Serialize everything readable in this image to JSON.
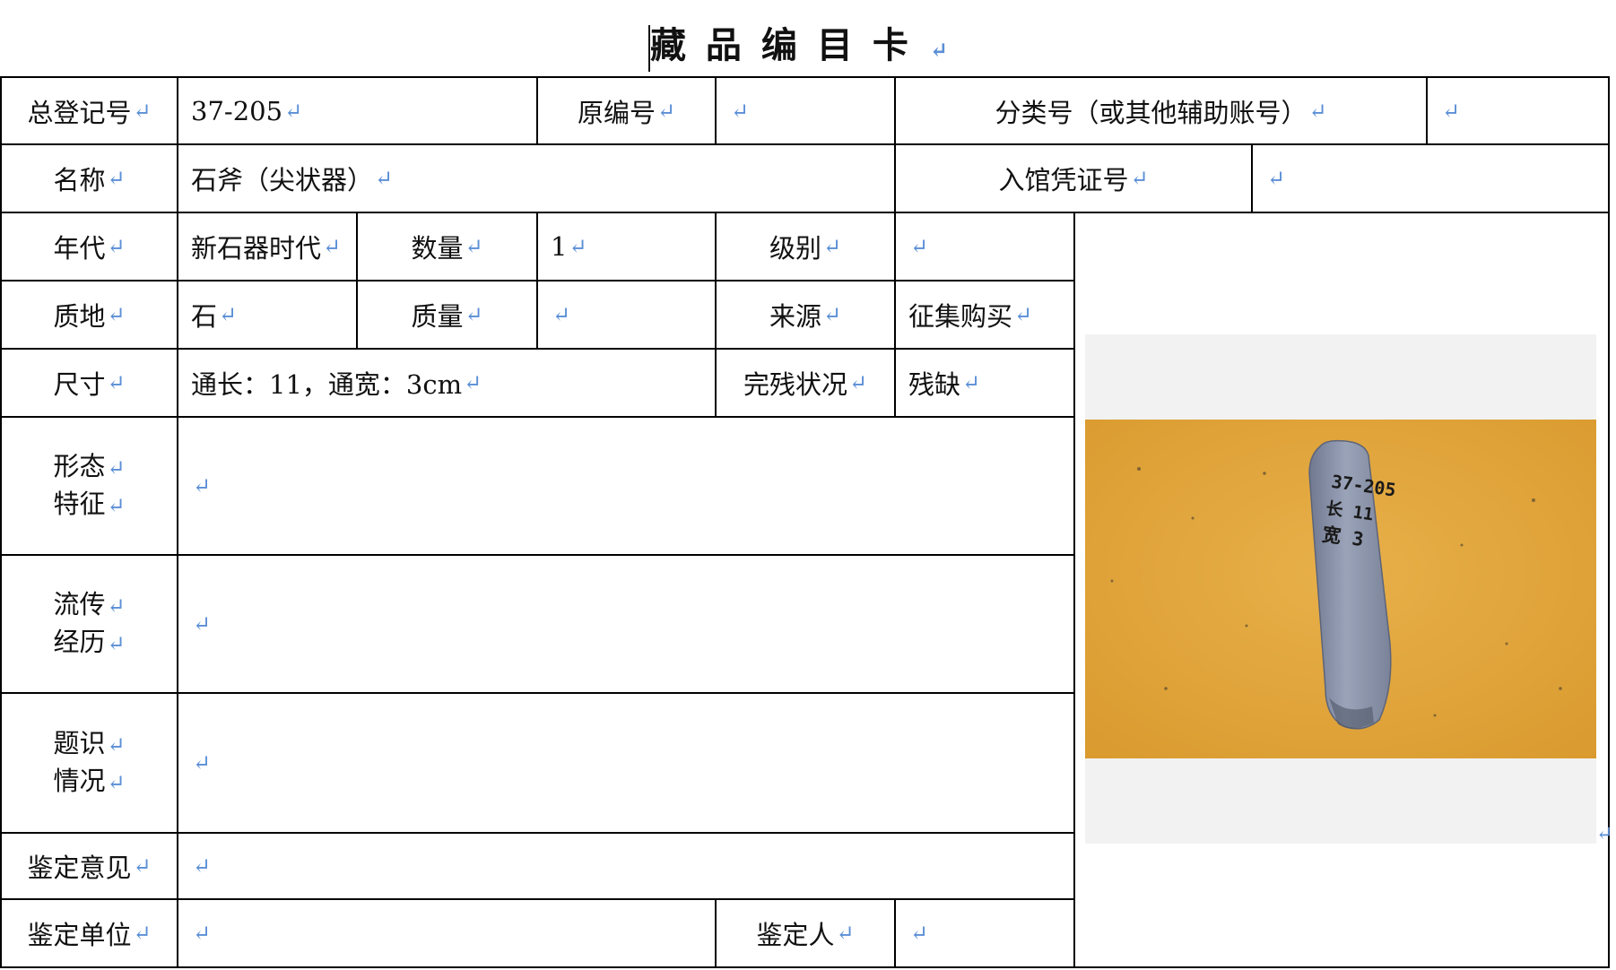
{
  "title": "藏品编目卡",
  "pilcrow": "↵",
  "labels": {
    "total_reg_no": "总登记号",
    "orig_no": "原编号",
    "category_no": "分类号（或其他辅助账号）",
    "name": "名称",
    "voucher_no": "入馆凭证号",
    "era": "年代",
    "quantity": "数量",
    "grade": "级别",
    "material": "质地",
    "mass": "质量",
    "source": "来源",
    "dimensions": "尺寸",
    "condition": "完残状况",
    "form_1": "形态",
    "form_2": "特征",
    "history_1": "流传",
    "history_2": "经历",
    "inscription_1": "题识",
    "inscription_2": "情况",
    "appraisal_opinion": "鉴定意见",
    "appraisal_unit": "鉴定单位",
    "appraiser": "鉴定人"
  },
  "values": {
    "total_reg_no": "37-205",
    "orig_no": "",
    "category_no": "",
    "name": "石斧（尖状器）",
    "voucher_no": "",
    "era": "新石器时代",
    "quantity": "1",
    "grade": "",
    "material": "石",
    "mass": "",
    "source": "征集购买",
    "dimensions": "通长：11，通宽：3cm",
    "condition": "残缺",
    "form": "",
    "history": "",
    "inscription": "",
    "appraisal_opinion": "",
    "appraisal_unit": "",
    "appraiser": ""
  },
  "photo": {
    "object_label_lines": [
      "37-205",
      "长 11",
      "宽 3"
    ],
    "background_color": "#e0a53a",
    "object_color": "#8e98ad"
  }
}
